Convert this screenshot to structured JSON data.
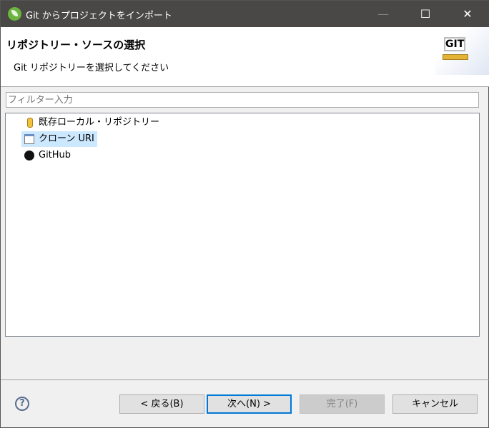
{
  "window": {
    "title": "Git からプロジェクトをインポート",
    "minimize": "—",
    "maximize": "☐",
    "close": "✕"
  },
  "header": {
    "title": "リポジトリー・ソースの選択",
    "subtitle": "Git リポジトリーを選択してください",
    "logo_text": "GIT"
  },
  "filter": {
    "placeholder": "フィルター入力",
    "value": ""
  },
  "tree": {
    "items": [
      {
        "label": "既存ローカル・リポジトリー",
        "icon": "repository-icon",
        "selected": false
      },
      {
        "label": "クローン URI",
        "icon": "clone-uri-icon",
        "selected": true
      },
      {
        "label": "GitHub",
        "icon": "github-icon",
        "selected": false
      }
    ]
  },
  "buttons": {
    "help": "?",
    "back": "< 戻る(B)",
    "next": "次へ(N) >",
    "finish": "完了(F)",
    "cancel": "キャンセル"
  }
}
